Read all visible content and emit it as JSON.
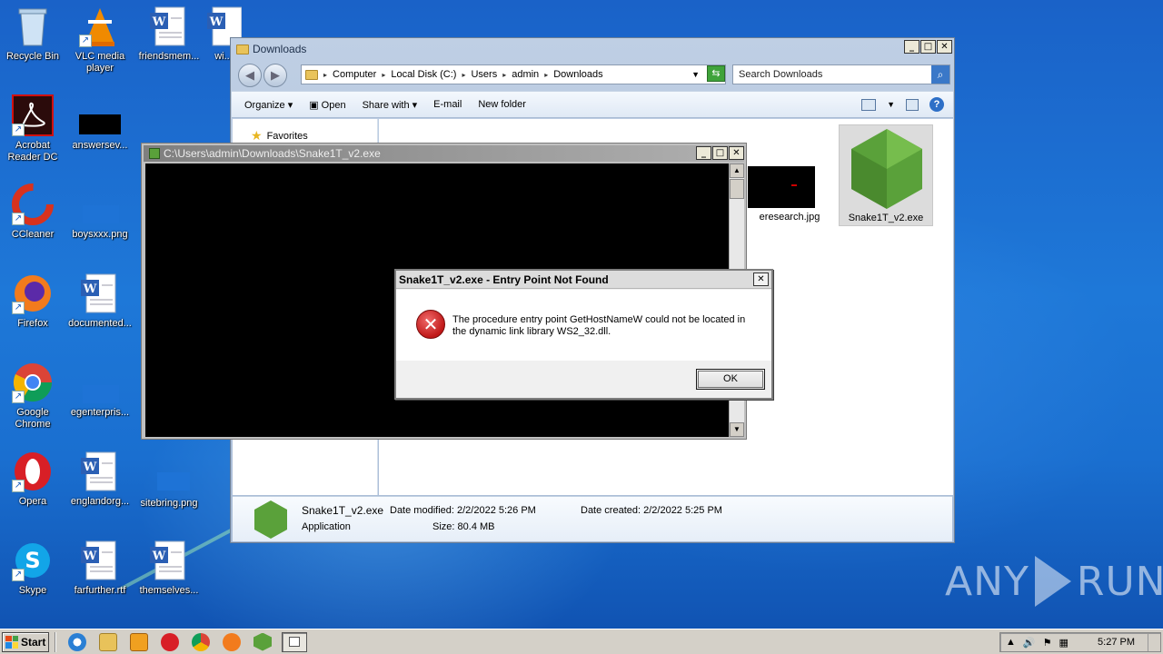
{
  "desktop": {
    "icons": [
      {
        "label": "Recycle Bin"
      },
      {
        "label": "VLC media player"
      },
      {
        "label": "friendsmem..."
      },
      {
        "label": "wi..."
      },
      {
        "label": "Acrobat Reader DC"
      },
      {
        "label": "answersev..."
      },
      {
        "label": "CCleaner"
      },
      {
        "label": "boysxxx.png"
      },
      {
        "label": "Firefox"
      },
      {
        "label": "documented..."
      },
      {
        "label": "Google Chrome"
      },
      {
        "label": "egenterpris..."
      },
      {
        "label": "Opera"
      },
      {
        "label": "englandorg..."
      },
      {
        "label": "sitebring.png"
      },
      {
        "label": "Skype"
      },
      {
        "label": "farfurther.rtf"
      },
      {
        "label": "themselves..."
      }
    ]
  },
  "explorer": {
    "title": "Downloads",
    "breadcrumb": [
      "Computer",
      "Local Disk (C:)",
      "Users",
      "admin",
      "Downloads"
    ],
    "search_placeholder": "Search Downloads",
    "toolbar": {
      "organize": "Organize",
      "open": "Open",
      "share_with": "Share with",
      "email": "E-mail",
      "new_folder": "New folder"
    },
    "nav": {
      "favorites": "Favorites"
    },
    "files": [
      {
        "name": "eresearch.jpg"
      },
      {
        "name": "Snake1T_v2.exe"
      }
    ],
    "details": {
      "name": "Snake1T_v2.exe",
      "type": "Application",
      "date_modified_label": "Date modified:",
      "date_modified": "2/2/2022 5:26 PM",
      "size_label": "Size:",
      "size": "80.4 MB",
      "date_created_label": "Date created:",
      "date_created": "2/2/2022 5:25 PM"
    }
  },
  "console": {
    "title": "C:\\Users\\admin\\Downloads\\Snake1T_v2.exe"
  },
  "dialog": {
    "title": "Snake1T_v2.exe - Entry Point Not Found",
    "message": "The procedure entry point GetHostNameW could not be located in the dynamic link library WS2_32.dll.",
    "ok_label": "OK"
  },
  "taskbar": {
    "start_label": "Start",
    "clock": "5:27 PM"
  },
  "watermark": {
    "left": "ANY",
    "right": "RUN"
  },
  "colors": {
    "desktop": "#1a6fd0",
    "error": "#c01818",
    "node_green": "#5aa13a"
  }
}
